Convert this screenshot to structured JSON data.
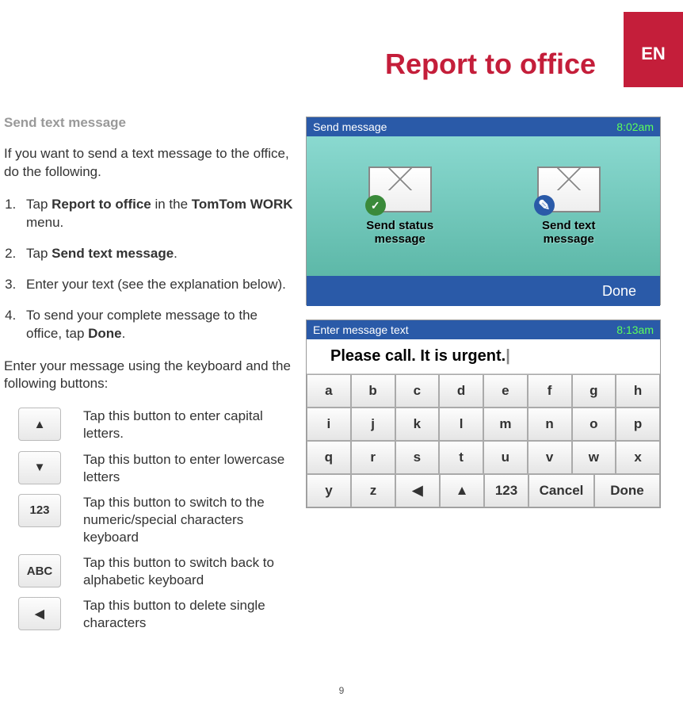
{
  "lang_tab": "EN",
  "page_title": "Report to office",
  "section_heading": "Send text message",
  "intro_text": "If you want to send a text message to the office, do the following.",
  "steps": [
    {
      "text_before": "Tap ",
      "bold1": "Report to office",
      "mid": " in the ",
      "bold2": "TomTom WORK",
      "text_after": " menu."
    },
    {
      "text_before": "Tap ",
      "bold1": "Send text message",
      "mid": "",
      "bold2": "",
      "text_after": "."
    },
    {
      "text_before": "Enter your text (see the explanation below).",
      "bold1": "",
      "mid": "",
      "bold2": "",
      "text_after": ""
    },
    {
      "text_before": "To send your complete message to the office, tap ",
      "bold1": "Done",
      "mid": "",
      "bold2": "",
      "text_after": "."
    }
  ],
  "followup_text": "Enter your message using the keyboard and the following buttons:",
  "buttons": [
    {
      "glyph": "▲",
      "desc": "Tap this button to enter capital letters."
    },
    {
      "glyph": "▼",
      "desc": "Tap this button to enter lowercase letters"
    },
    {
      "glyph": "123",
      "desc": "Tap this button to switch to the numeric/special characters keyboard"
    },
    {
      "glyph": "ABC",
      "desc": "Tap this button to switch back to alphabetic keyboard"
    },
    {
      "glyph": "◀",
      "desc": "Tap this button to delete single characters"
    }
  ],
  "screenshot1": {
    "title": "Send message",
    "time": "8:02am",
    "icon1_label_l1": "Send status",
    "icon1_label_l2": "message",
    "icon2_label_l1": "Send text",
    "icon2_label_l2": "message",
    "done_label": "Done"
  },
  "screenshot2": {
    "title": "Enter message text",
    "time": "8:13am",
    "input_text": "Please call. It is urgent.",
    "keys": {
      "r1": [
        "a",
        "b",
        "c",
        "d",
        "e",
        "f",
        "g",
        "h"
      ],
      "r2": [
        "i",
        "j",
        "k",
        "l",
        "m",
        "n",
        "o",
        "p"
      ],
      "r3": [
        "q",
        "r",
        "s",
        "t",
        "u",
        "v",
        "w",
        "x"
      ],
      "r4": [
        "y",
        "z",
        "◀",
        "▲",
        "123",
        "Cancel",
        "Done"
      ]
    }
  },
  "page_number": "9"
}
